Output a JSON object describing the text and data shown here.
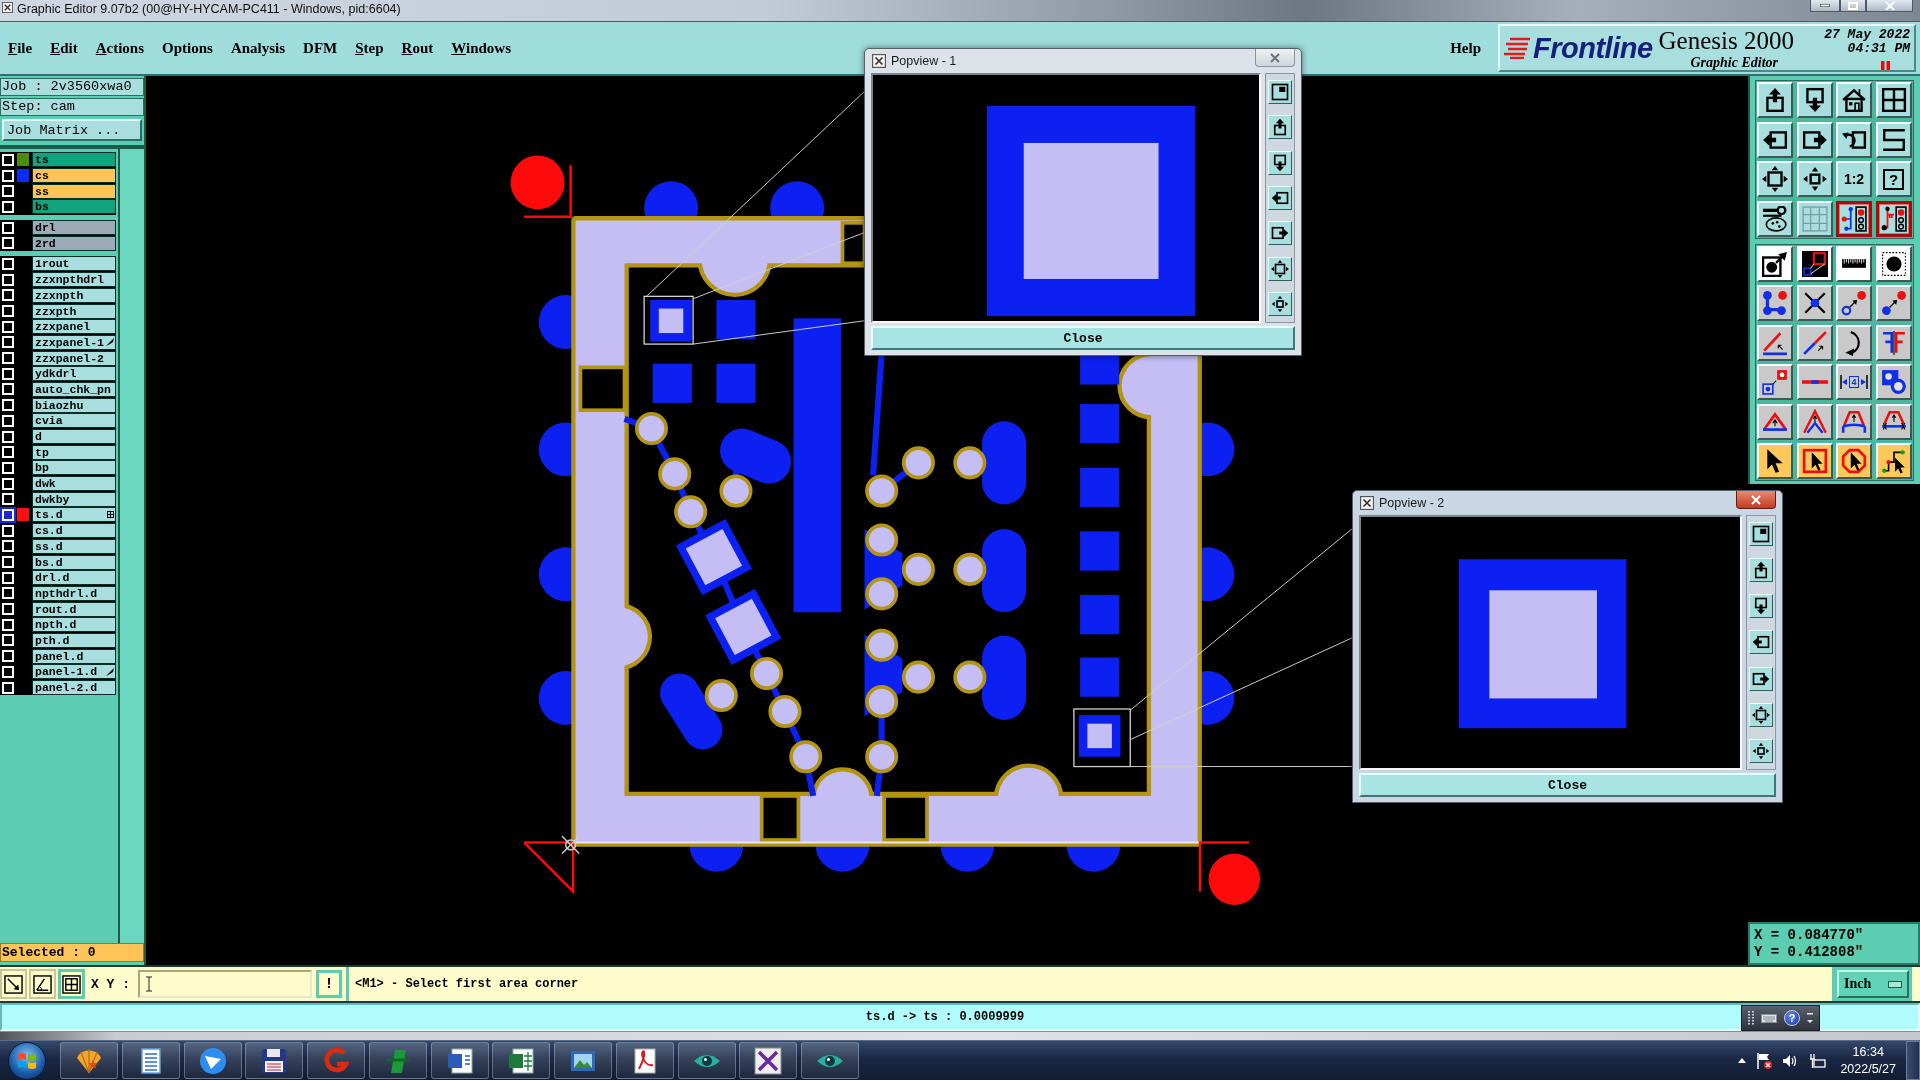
{
  "window": {
    "title": "Graphic Editor 9.07b2 (00@HY-HYCAM-PC411 - Windows, pid:6604)"
  },
  "menu": [
    {
      "label": "File",
      "underlined": true
    },
    {
      "label": "Edit",
      "underlined": true
    },
    {
      "label": "Actions",
      "underlined": true
    },
    {
      "label": "Options",
      "underlined": false
    },
    {
      "label": "Analysis",
      "underlined": false
    },
    {
      "label": "DFM",
      "underlined": false
    },
    {
      "label": "Step",
      "underlined": true
    },
    {
      "label": "Rout",
      "underlined": true
    },
    {
      "label": "Windows",
      "underlined": true
    }
  ],
  "help_menu": "Help",
  "branding": {
    "logo": "Frontline",
    "product": "Genesis 2000",
    "module": "Graphic Editor",
    "date": "27 May 2022",
    "time": "04:31 PM"
  },
  "job": {
    "job": "Job : 2v3560xwa0",
    "step": "Step: cam",
    "matrix_button": "Job Matrix ..."
  },
  "layer_groups": [
    {
      "layers": [
        {
          "name": "ts",
          "kind": "solder_mask",
          "selected": false,
          "work_layer": false,
          "annotated": false,
          "color": "#4a8c10"
        },
        {
          "name": "cs",
          "kind": "signal",
          "selected": false,
          "work_layer": false,
          "annotated": false,
          "color": "#0a2cff"
        },
        {
          "name": "ss",
          "kind": "signal",
          "selected": false,
          "work_layer": false,
          "annotated": false
        },
        {
          "name": "bs",
          "kind": "solder_mask",
          "selected": false,
          "work_layer": false,
          "annotated": false
        }
      ]
    },
    {
      "layers": [
        {
          "name": "drl",
          "kind": "drill",
          "selected": false,
          "work_layer": false,
          "annotated": false
        },
        {
          "name": "2rd",
          "kind": "drill",
          "selected": false,
          "work_layer": false,
          "annotated": false
        }
      ]
    },
    {
      "layers": [
        {
          "name": "1rout",
          "kind": "document",
          "selected": false,
          "work_layer": false,
          "annotated": false
        },
        {
          "name": "zzxnpthdrl",
          "kind": "document",
          "selected": false,
          "work_layer": false,
          "annotated": false
        },
        {
          "name": "zzxnpth",
          "kind": "document",
          "selected": false,
          "work_layer": false,
          "annotated": false
        },
        {
          "name": "zzxpth",
          "kind": "document",
          "selected": false,
          "work_layer": false,
          "annotated": false
        },
        {
          "name": "zzxpanel",
          "kind": "document",
          "selected": false,
          "work_layer": false,
          "annotated": false
        },
        {
          "name": "zzxpanel-1",
          "kind": "document",
          "selected": false,
          "work_layer": false,
          "annotated": true
        },
        {
          "name": "zzxpanel-2",
          "kind": "document",
          "selected": false,
          "work_layer": false,
          "annotated": false
        },
        {
          "name": "ydkdrl",
          "kind": "document",
          "selected": false,
          "work_layer": false,
          "annotated": false
        },
        {
          "name": "auto_chk_pn",
          "kind": "document",
          "selected": false,
          "work_layer": false,
          "annotated": false
        },
        {
          "name": "biaozhu",
          "kind": "document",
          "selected": false,
          "work_layer": false,
          "annotated": false
        },
        {
          "name": "cvia",
          "kind": "document",
          "selected": false,
          "work_layer": false,
          "annotated": false
        },
        {
          "name": "d",
          "kind": "document",
          "selected": false,
          "work_layer": false,
          "annotated": false
        },
        {
          "name": "tp",
          "kind": "document",
          "selected": false,
          "work_layer": false,
          "annotated": false
        },
        {
          "name": "bp",
          "kind": "document",
          "selected": false,
          "work_layer": false,
          "annotated": false
        },
        {
          "name": "dwk",
          "kind": "document",
          "selected": false,
          "work_layer": false,
          "annotated": false
        },
        {
          "name": "dwkby",
          "kind": "document",
          "selected": false,
          "work_layer": false,
          "annotated": false
        },
        {
          "name": "ts.d",
          "kind": "document",
          "selected": true,
          "work_layer": true,
          "annotated": false,
          "color": "#ff1010"
        },
        {
          "name": "cs.d",
          "kind": "document",
          "selected": false,
          "work_layer": false,
          "annotated": false
        },
        {
          "name": "ss.d",
          "kind": "document",
          "selected": false,
          "work_layer": false,
          "annotated": false
        },
        {
          "name": "bs.d",
          "kind": "document",
          "selected": false,
          "work_layer": false,
          "annotated": false
        },
        {
          "name": "drl.d",
          "kind": "document",
          "selected": false,
          "work_layer": false,
          "annotated": false
        },
        {
          "name": "npthdrl.d",
          "kind": "document",
          "selected": false,
          "work_layer": false,
          "annotated": false
        },
        {
          "name": "rout.d",
          "kind": "document",
          "selected": false,
          "work_layer": false,
          "annotated": false
        },
        {
          "name": "npth.d",
          "kind": "document",
          "selected": false,
          "work_layer": false,
          "annotated": false
        },
        {
          "name": "pth.d",
          "kind": "document",
          "selected": false,
          "work_layer": false,
          "annotated": false
        },
        {
          "name": "panel.d",
          "kind": "document",
          "selected": false,
          "work_layer": false,
          "annotated": false
        },
        {
          "name": "panel-1.d",
          "kind": "document",
          "selected": false,
          "work_layer": false,
          "annotated": true
        },
        {
          "name": "panel-2.d",
          "kind": "document",
          "selected": false,
          "work_layer": false,
          "annotated": false
        }
      ]
    }
  ],
  "selected_count": "Selected : 0",
  "view_tools": [
    {
      "kind": "icon",
      "on": false
    },
    {
      "kind": "icon",
      "on": false
    },
    {
      "kind": "icon",
      "on": false
    },
    {
      "kind": "icon",
      "on": false
    },
    {
      "kind": "icon",
      "on": false
    },
    {
      "kind": "icon",
      "on": false
    },
    {
      "kind": "icon",
      "on": false
    },
    {
      "kind": "icon",
      "on": false
    },
    {
      "kind": "icon",
      "on": false
    },
    {
      "kind": "icon",
      "on": false
    },
    {
      "kind": "text",
      "label": "1:2",
      "on": false
    },
    {
      "kind": "boxed",
      "label": "?",
      "on": false
    },
    {
      "kind": "icon",
      "on": false
    },
    {
      "kind": "icon",
      "on": false
    },
    {
      "kind": "icon",
      "on": true
    },
    {
      "kind": "icon",
      "on": true
    }
  ],
  "edit_tools": [
    {
      "kind": "icon",
      "on": false
    },
    {
      "kind": "icon",
      "on": false
    },
    {
      "kind": "icon",
      "on": false
    },
    {
      "kind": "icon",
      "on": false
    },
    {
      "kind": "icon",
      "on": false
    },
    {
      "kind": "icon",
      "on": false
    },
    {
      "kind": "icon",
      "on": false
    },
    {
      "kind": "icon",
      "on": false
    },
    {
      "kind": "icon",
      "on": false
    },
    {
      "kind": "icon",
      "on": false
    },
    {
      "kind": "icon",
      "on": false
    },
    {
      "kind": "icon",
      "on": false
    },
    {
      "kind": "icon",
      "on": false
    },
    {
      "kind": "icon",
      "on": false
    },
    {
      "kind": "measure",
      "label": "4",
      "on": false
    },
    {
      "kind": "icon",
      "on": false
    },
    {
      "kind": "icon",
      "on": false
    },
    {
      "kind": "icon",
      "on": false
    },
    {
      "kind": "icon",
      "on": false
    },
    {
      "kind": "icon",
      "on": false
    },
    {
      "kind": "icon",
      "on": false
    },
    {
      "kind": "icon",
      "on": false
    },
    {
      "kind": "icon",
      "on": false
    },
    {
      "kind": "icon",
      "on": false
    }
  ],
  "coordinates": {
    "x": "X = 0.084770\"",
    "y": "Y = 0.412808\""
  },
  "popviews": [
    {
      "title": "Popview - 1",
      "active": false,
      "close_button": "Close"
    },
    {
      "title": "Popview - 2",
      "active": true,
      "close_button": "Close"
    }
  ],
  "prompt_bar": {
    "tools": [
      {
        "on": false
      },
      {
        "on": false
      },
      {
        "on": true
      }
    ],
    "xy_label": "X Y :",
    "run_button": "!",
    "message": "<M1> - Select first area corner",
    "units": "Inch"
  },
  "status_bar": {
    "message": "ts.d -> ts : 0.0009999"
  },
  "language_bar": {
    "help": "?"
  },
  "taskbar": {
    "time": "16:34",
    "date": "2022/5/27"
  }
}
